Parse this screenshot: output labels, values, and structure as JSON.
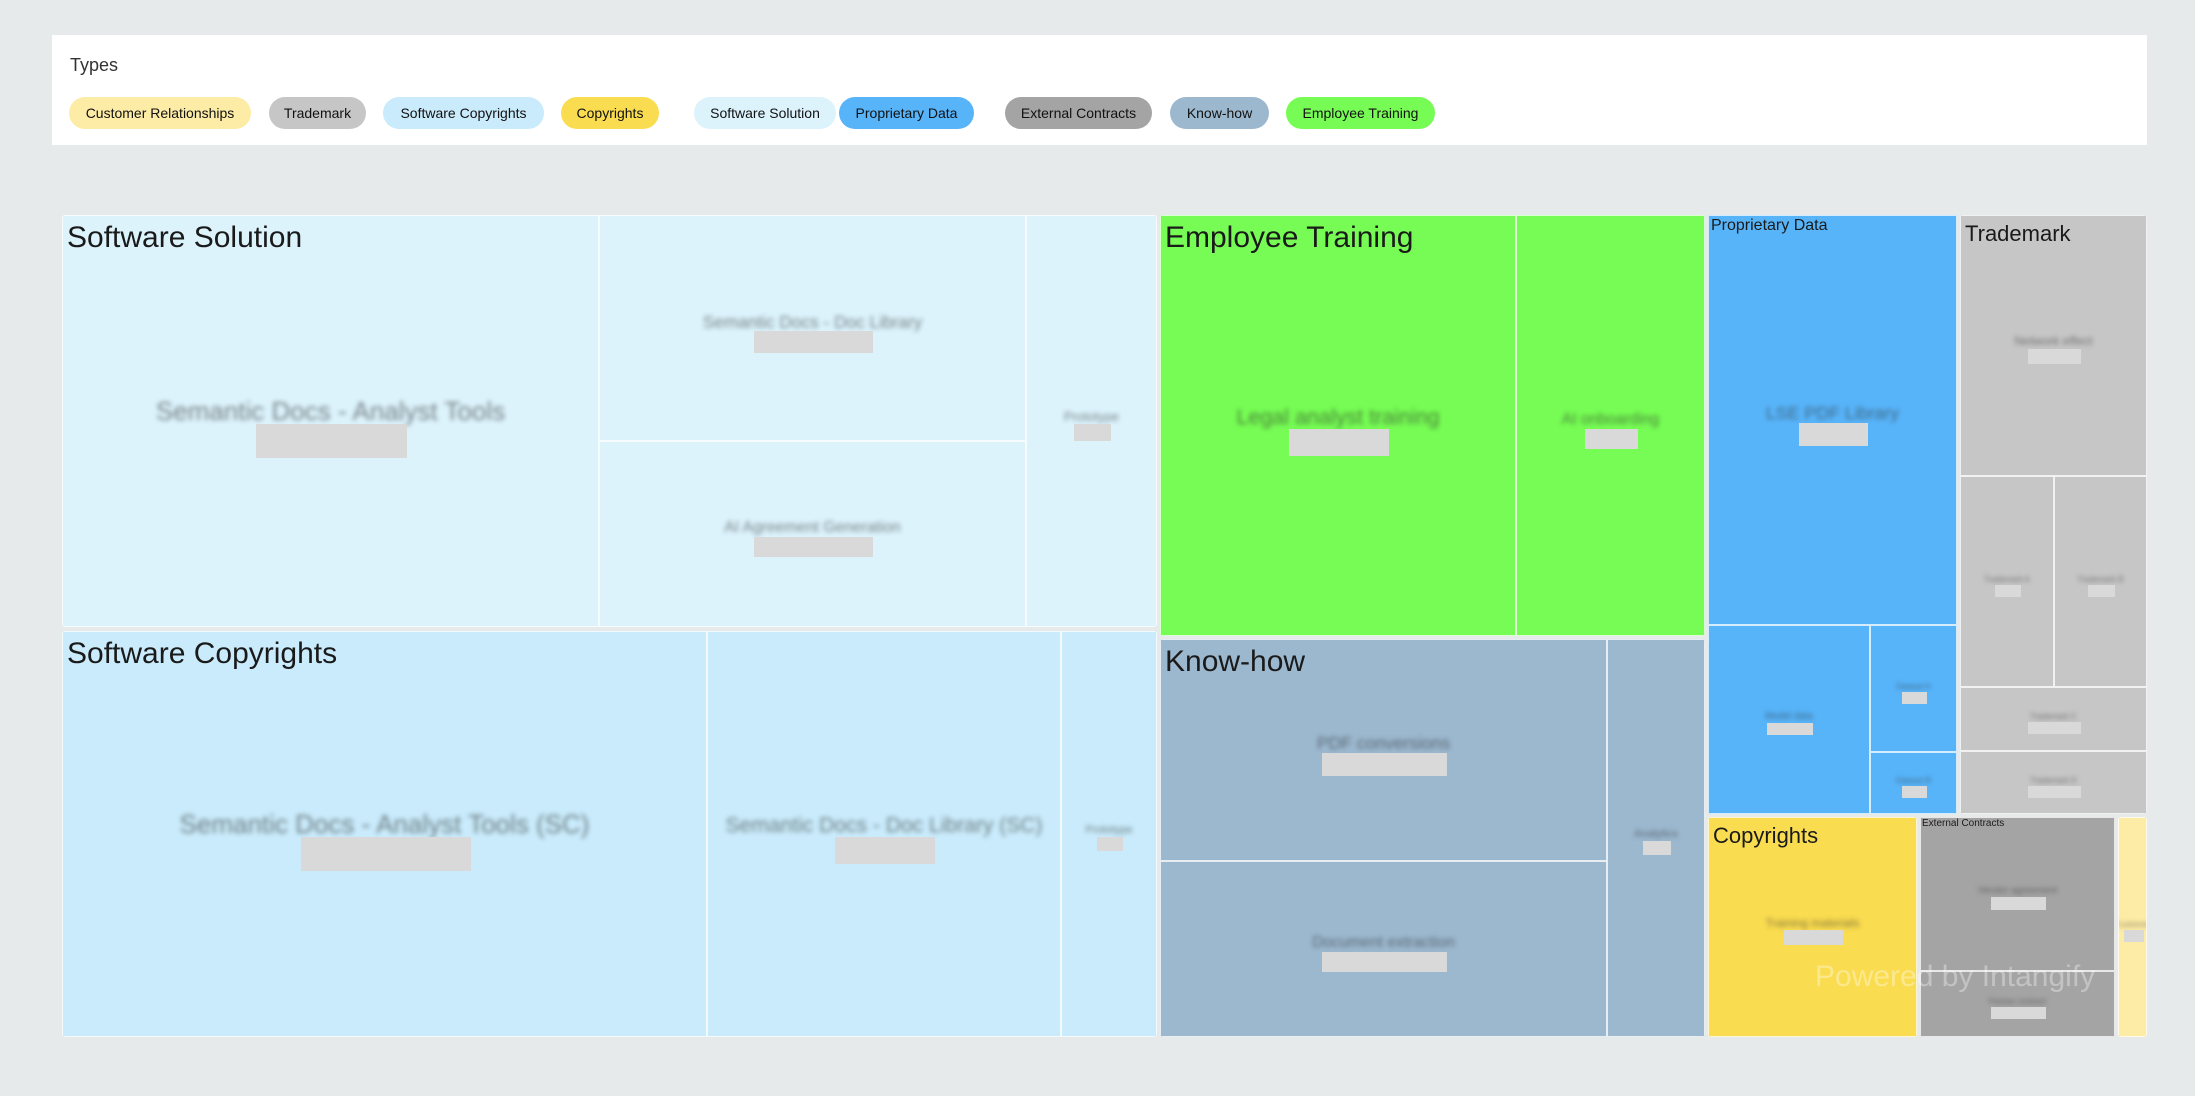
{
  "legend": {
    "title": "Types",
    "items": [
      {
        "label": "Customer Relationships",
        "color": "#fdeca6"
      },
      {
        "label": "Trademark",
        "color": "#c6c6c6"
      },
      {
        "label": "Software Copyrights",
        "color": "#c9ebfb"
      },
      {
        "label": "Copyrights",
        "color": "#fadc50"
      },
      {
        "label": "Software Solution",
        "color": "#dcf3fc"
      },
      {
        "label": "Proprietary Data",
        "color": "#58b4f9"
      },
      {
        "label": "External Contracts",
        "color": "#a4a4a4"
      },
      {
        "label": "Know-how",
        "color": "#9cb8cf"
      },
      {
        "label": "Employee Training",
        "color": "#76fc54"
      }
    ]
  },
  "chart_data": {
    "type": "treemap",
    "groups": [
      {
        "name": "Software Solution",
        "color": "#dcf3fc",
        "label_size": "large",
        "children": [
          {
            "name": "Semantic Docs - Analyst Tools",
            "value": 113
          },
          {
            "name": "Semantic Docs - Doc Library",
            "value": 50
          },
          {
            "name": "AI Agreement Generation",
            "value": 42
          },
          {
            "name": "Prototype",
            "value": 27
          }
        ]
      },
      {
        "name": "Software Copyrights",
        "color": "#c9ebfb",
        "label_size": "large",
        "children": [
          {
            "name": "Semantic Docs - Analyst Tools (SC)",
            "value": 133
          },
          {
            "name": "Semantic Docs - Doc Library (SC)",
            "value": 73
          },
          {
            "name": "Prototype",
            "value": 20
          }
        ]
      },
      {
        "name": "Employee Training",
        "color": "#76fc54",
        "label_size": "large",
        "children": [
          {
            "name": "Legal analyst training",
            "value": 76
          },
          {
            "name": "AI onboarding",
            "value": 40
          }
        ]
      },
      {
        "name": "Know-how",
        "color": "#9cb8cf",
        "label_size": "large",
        "children": [
          {
            "name": "PDF conversions",
            "value": 45
          },
          {
            "name": "Document extraction",
            "value": 40
          },
          {
            "name": "Analytics",
            "value": 18
          }
        ]
      },
      {
        "name": "Proprietary Data",
        "color": "#58b4f9",
        "label_size": "small",
        "children": [
          {
            "name": "LSE PDF Library",
            "value": 51
          },
          {
            "name": "Model data",
            "value": 16
          },
          {
            "name": "Dataset A",
            "value": 8
          },
          {
            "name": "Dataset B",
            "value": 4
          }
        ]
      },
      {
        "name": "Trademark",
        "color": "#c6c6c6",
        "label_size": "medium",
        "children": [
          {
            "name": "Network effect",
            "value": 25
          },
          {
            "name": "Trademark A",
            "value": 10
          },
          {
            "name": "Trademark B",
            "value": 10
          },
          {
            "name": "Trademark C",
            "value": 6
          },
          {
            "name": "Trademark D",
            "value": 6
          }
        ]
      },
      {
        "name": "Copyrights",
        "color": "#fadc50",
        "label_size": "medium",
        "children": [
          {
            "name": "Training materials",
            "value": 24
          }
        ]
      },
      {
        "name": "External Contracts",
        "color": "#a4a4a4",
        "label_size": "tiny",
        "children": [
          {
            "name": "Vendor agreement",
            "value": 13
          },
          {
            "name": "Partner contract",
            "value": 8
          }
        ]
      },
      {
        "name": "Customer Relationships",
        "color": "#fdeca6",
        "label_size": "none",
        "children": [
          {
            "name": "Customer",
            "value": 3
          }
        ]
      }
    ]
  },
  "watermark": "Powered by Intangify"
}
